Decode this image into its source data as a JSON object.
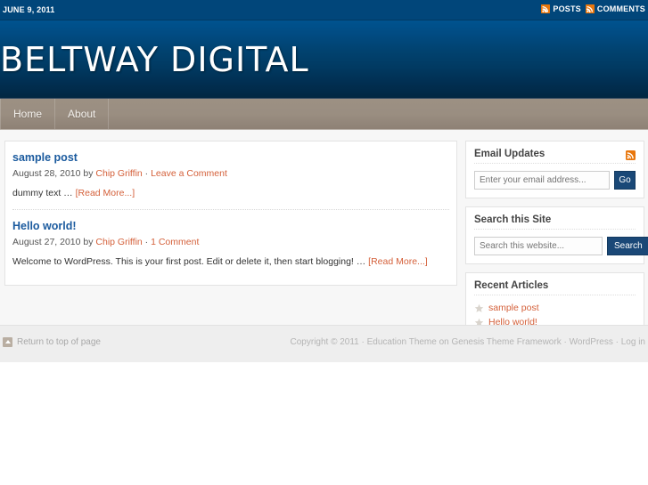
{
  "topbar": {
    "date": "JUNE 9, 2011",
    "links": [
      {
        "label": "POSTS",
        "icon": "rss-icon"
      },
      {
        "label": "COMMENTS",
        "icon": "rss-icon"
      }
    ]
  },
  "header": {
    "site_title": "BELTWAY DIGITAL"
  },
  "nav": {
    "items": [
      {
        "label": "Home"
      },
      {
        "label": "About"
      }
    ]
  },
  "content": {
    "posts": [
      {
        "title": "sample post",
        "date": "August 28, 2010",
        "by_label": "by",
        "author": "Chip Griffin",
        "meta_sep": "·",
        "comments": "Leave a Comment",
        "excerpt": "dummy text … ",
        "read_more": "[Read More...]"
      },
      {
        "title": "Hello world!",
        "date": "August 27, 2010",
        "by_label": "by",
        "author": "Chip Griffin",
        "meta_sep": "·",
        "comments": "1 Comment",
        "excerpt": "Welcome to WordPress. This is your first post. Edit or delete it, then start blogging! … ",
        "read_more": "[Read More...]"
      }
    ]
  },
  "sidebar": {
    "email_widget": {
      "title": "Email Updates",
      "rss_icon": "rss-icon",
      "input_placeholder": "Enter your email address...",
      "input_value": "",
      "button_label": "Go"
    },
    "search_widget": {
      "title": "Search this Site",
      "input_placeholder": "Search this website...",
      "input_value": "",
      "button_label": "Search"
    },
    "recent_widget": {
      "title": "Recent Articles",
      "items": [
        {
          "label": "sample post",
          "icon": "star-icon"
        },
        {
          "label": "Hello world!",
          "icon": "star-icon"
        }
      ]
    }
  },
  "footer": {
    "return_top_label": "Return to top of page",
    "return_top_icon": "arrow-up-icon",
    "copyright": "Copyright © 2011 · Education Theme on Genesis Theme Framework · WordPress · Log in"
  },
  "colors": {
    "topbar_bg": "#01467a",
    "header_gradient_top": "#00538f",
    "header_gradient_bottom": "#012742",
    "nav_bg": "#9a8e81",
    "accent_orange": "#d4603a",
    "rss_orange": "#e8760c",
    "link_blue": "#1a5a9e",
    "button_navy": "#1a4877",
    "page_bg": "#f7f7f7",
    "footer_bg": "#eeeeee"
  }
}
